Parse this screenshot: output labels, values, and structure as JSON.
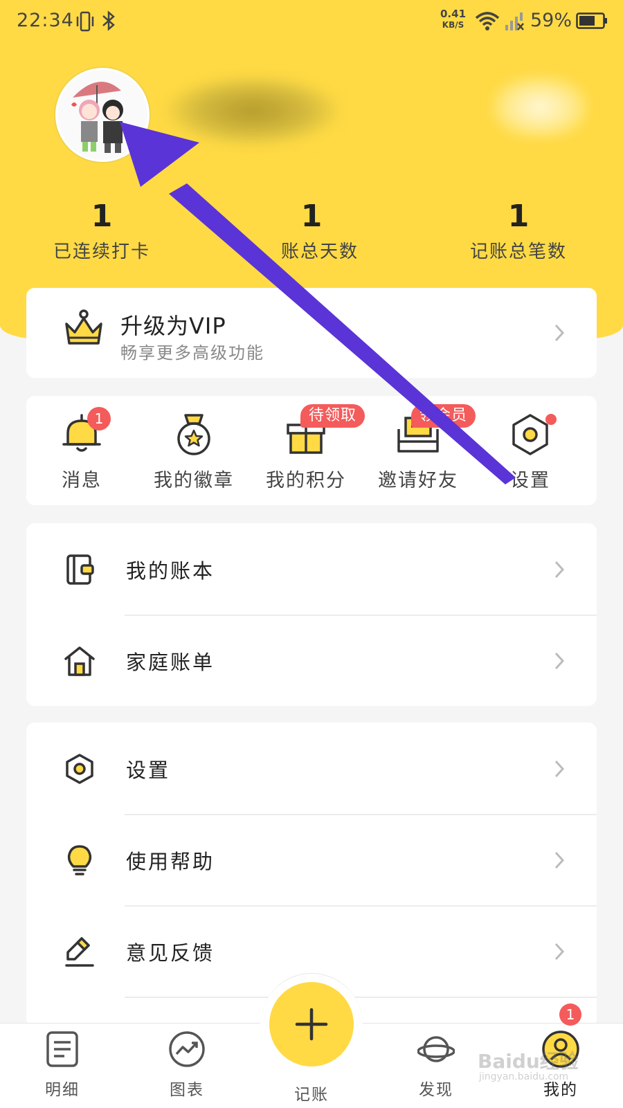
{
  "status_bar": {
    "time": "22:34",
    "net_speed_value": "0.41",
    "net_speed_unit": "KB/S",
    "battery": "59%"
  },
  "profile": {
    "stats": [
      {
        "value": "1",
        "label": "已连续打卡"
      },
      {
        "value": "1",
        "label": "账总天数"
      },
      {
        "value": "1",
        "label": "记账总笔数"
      }
    ]
  },
  "vip": {
    "title": "升级为VIP",
    "subtitle": "畅享更多高级功能"
  },
  "quick_actions": [
    {
      "label": "消息",
      "icon": "bell-icon",
      "badge": "1"
    },
    {
      "label": "我的徽章",
      "icon": "medal-icon"
    },
    {
      "label": "我的积分",
      "icon": "gift-box-icon",
      "tag": "待领取"
    },
    {
      "label": "邀请好友",
      "icon": "envelope-icon",
      "tag": "领会员"
    },
    {
      "label": "设置",
      "icon": "settings-hex-icon"
    }
  ],
  "menu_group_1": [
    {
      "label": "我的账本",
      "icon": "ledger-icon"
    },
    {
      "label": "家庭账单",
      "icon": "house-icon"
    }
  ],
  "menu_group_2": [
    {
      "label": "设置",
      "icon": "settings-hex-icon"
    },
    {
      "label": "使用帮助",
      "icon": "lightbulb-icon"
    },
    {
      "label": "意见反馈",
      "icon": "pencil-icon"
    }
  ],
  "tab_bar": {
    "tabs": [
      {
        "label": "明细",
        "icon": "list-icon"
      },
      {
        "label": "图表",
        "icon": "chart-icon"
      },
      {
        "label": "记账",
        "icon": "plus-icon"
      },
      {
        "label": "发现",
        "icon": "planet-icon"
      },
      {
        "label": "我的",
        "icon": "user-icon",
        "badge": "1"
      }
    ]
  },
  "watermark": {
    "brand": "Baidu经验",
    "url": "jingyan.baidu.com"
  },
  "colors": {
    "accent": "#ffda44",
    "badge": "#f45b5b",
    "annotation_arrow": "#5a34d6"
  }
}
